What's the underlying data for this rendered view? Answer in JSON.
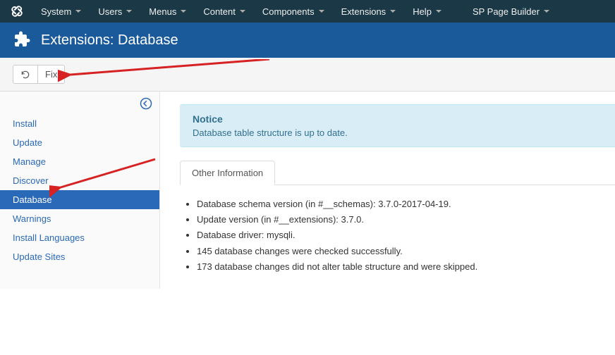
{
  "topmenu": {
    "items": [
      "System",
      "Users",
      "Menus",
      "Content",
      "Components",
      "Extensions",
      "Help"
    ],
    "extra": "SP Page Builder"
  },
  "header": {
    "title": "Extensions: Database"
  },
  "toolbar": {
    "fix_label": "Fix"
  },
  "sidebar": {
    "items": [
      {
        "label": "Install"
      },
      {
        "label": "Update"
      },
      {
        "label": "Manage"
      },
      {
        "label": "Discover"
      },
      {
        "label": "Database",
        "active": true
      },
      {
        "label": "Warnings"
      },
      {
        "label": "Install Languages"
      },
      {
        "label": "Update Sites"
      }
    ]
  },
  "notice": {
    "title": "Notice",
    "text": "Database table structure is up to date."
  },
  "tab": {
    "label": "Other Information"
  },
  "info": {
    "lines": [
      "Database schema version (in #__schemas): 3.7.0-2017-04-19.",
      "Update version (in #__extensions): 3.7.0.",
      "Database driver: mysqli.",
      "145 database changes were checked successfully.",
      "173 database changes did not alter table structure and were skipped."
    ]
  }
}
